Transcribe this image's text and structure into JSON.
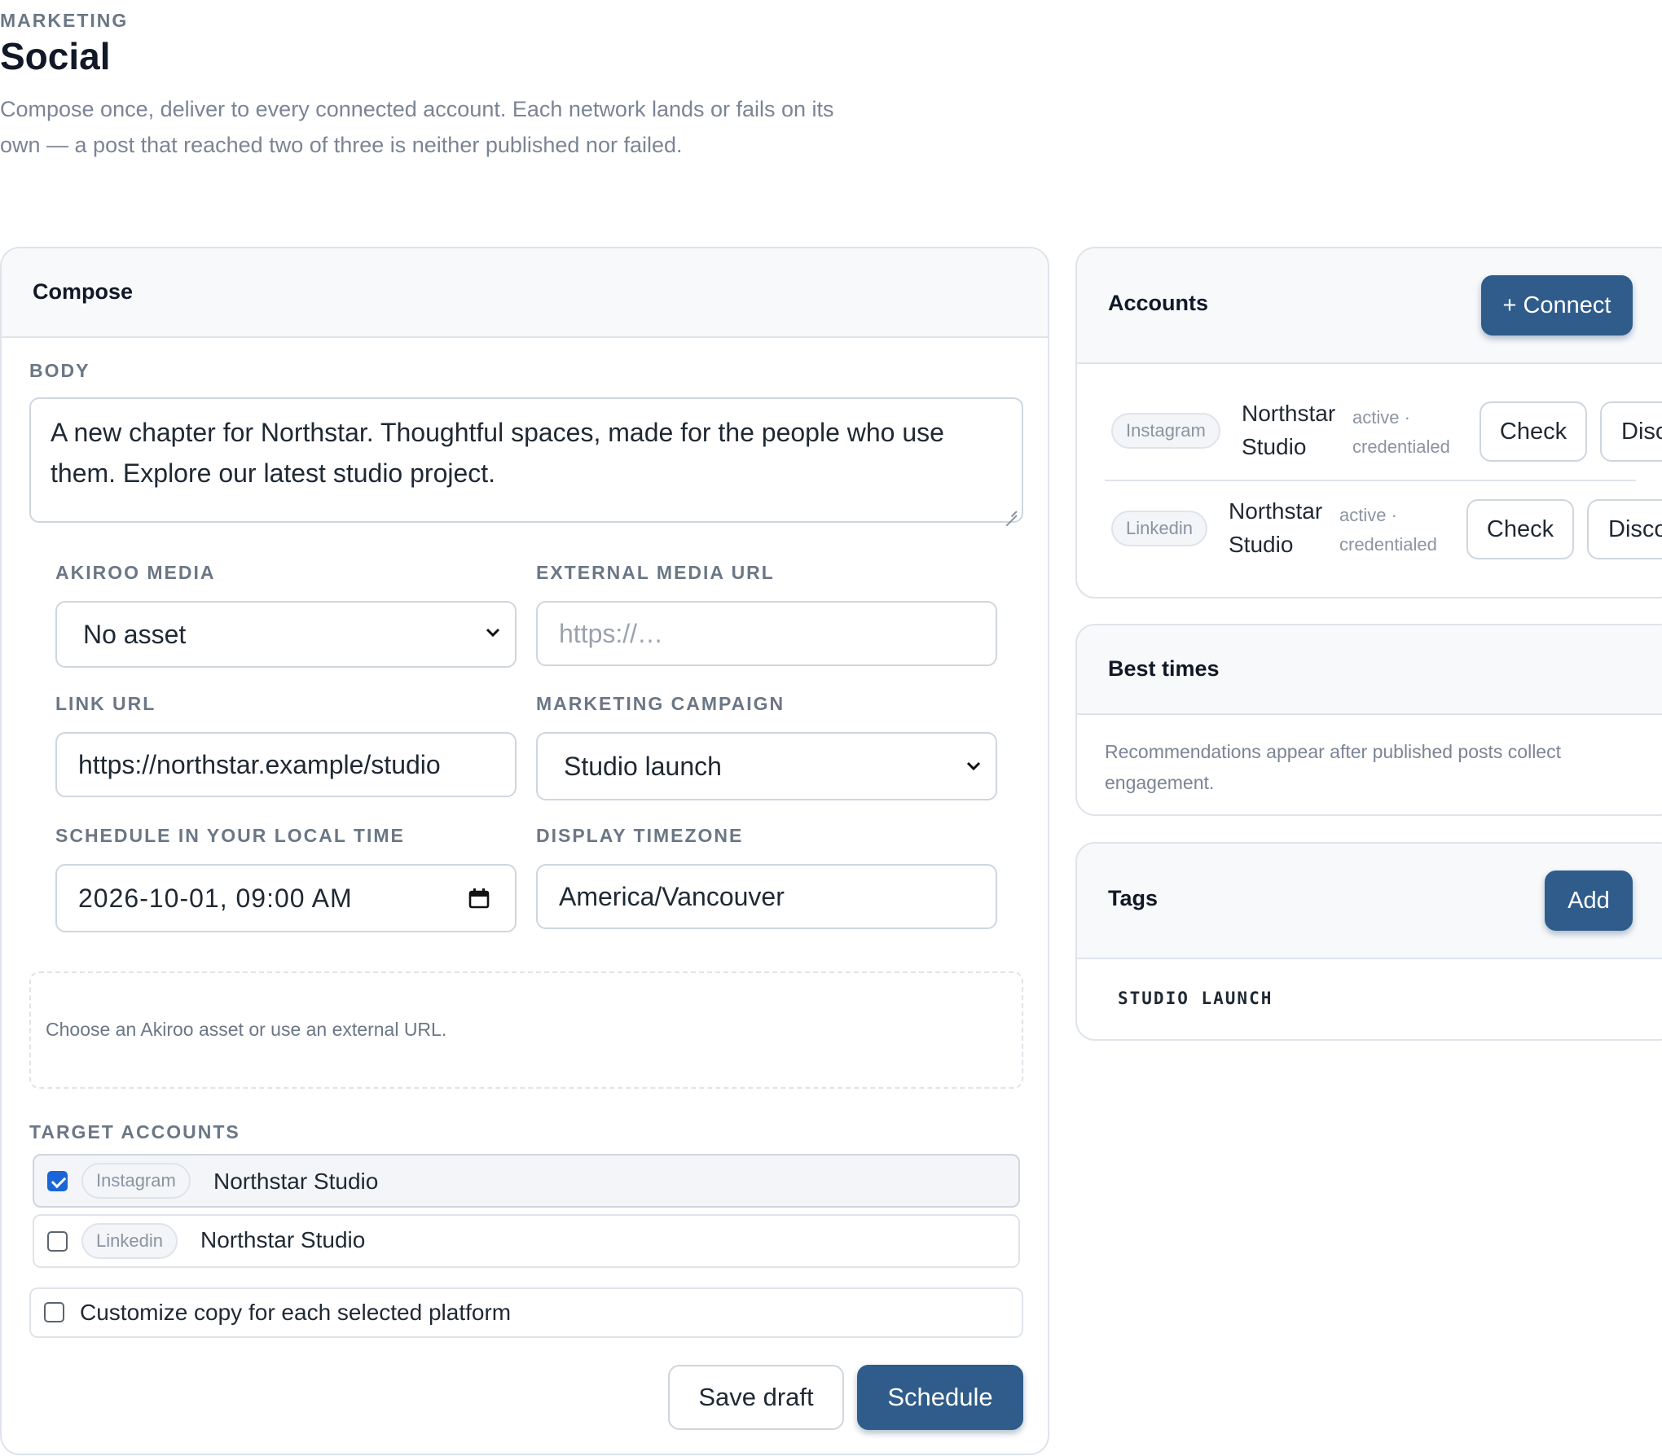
{
  "header": {
    "eyebrow": "MARKETING",
    "title": "Social",
    "description": "Compose once, deliver to every connected account. Each network lands or fails on its own — a post that reached two of three is neither published nor failed."
  },
  "compose": {
    "title": "Compose",
    "body_label": "BODY",
    "body_value": "A new chapter for Northstar. Thoughtful spaces, made for the people who use them. Explore our latest studio project.",
    "media_label": "AKIROO MEDIA",
    "media_value": "No asset",
    "external_url_label": "EXTERNAL MEDIA URL",
    "external_url_placeholder": "https://…",
    "link_url_label": "LINK URL",
    "link_url_value": "https://northstar.example/studio",
    "campaign_label": "MARKETING CAMPAIGN",
    "campaign_value": "Studio launch",
    "schedule_label": "SCHEDULE IN YOUR LOCAL TIME",
    "schedule_value": "2026-10-01, 09:00 AM",
    "timezone_label": "DISPLAY TIMEZONE",
    "timezone_value": "America/Vancouver",
    "media_hint": "Choose an Akiroo asset or use an external URL.",
    "target_accounts_label": "TARGET ACCOUNTS",
    "target_accounts": [
      {
        "platform": "Instagram",
        "name": "Northstar Studio",
        "checked": true
      },
      {
        "platform": "Linkedin",
        "name": "Northstar Studio",
        "checked": false
      }
    ],
    "customize_label": "Customize copy for each selected platform",
    "customize_checked": false,
    "save_draft_label": "Save draft",
    "schedule_button_label": "Schedule"
  },
  "accounts": {
    "title": "Accounts",
    "connect_label": "+ Connect",
    "items": [
      {
        "platform": "Instagram",
        "name_line1": "Northstar",
        "name_line2": "Studio",
        "status_line1": "active ·",
        "status_line2": "credentialed",
        "check_label": "Check",
        "disconnect_label": "Disconnect"
      },
      {
        "platform": "Linkedin",
        "name_line1": "Northstar",
        "name_line2": "Studio",
        "status_line1": "active ·",
        "status_line2": "credentialed",
        "check_label": "Check",
        "disconnect_label": "Disconnect"
      }
    ]
  },
  "best_times": {
    "title": "Best times",
    "text": "Recommendations appear after published posts collect engagement."
  },
  "tags": {
    "title": "Tags",
    "add_label": "Add",
    "items": [
      "STUDIO LAUNCH"
    ]
  }
}
